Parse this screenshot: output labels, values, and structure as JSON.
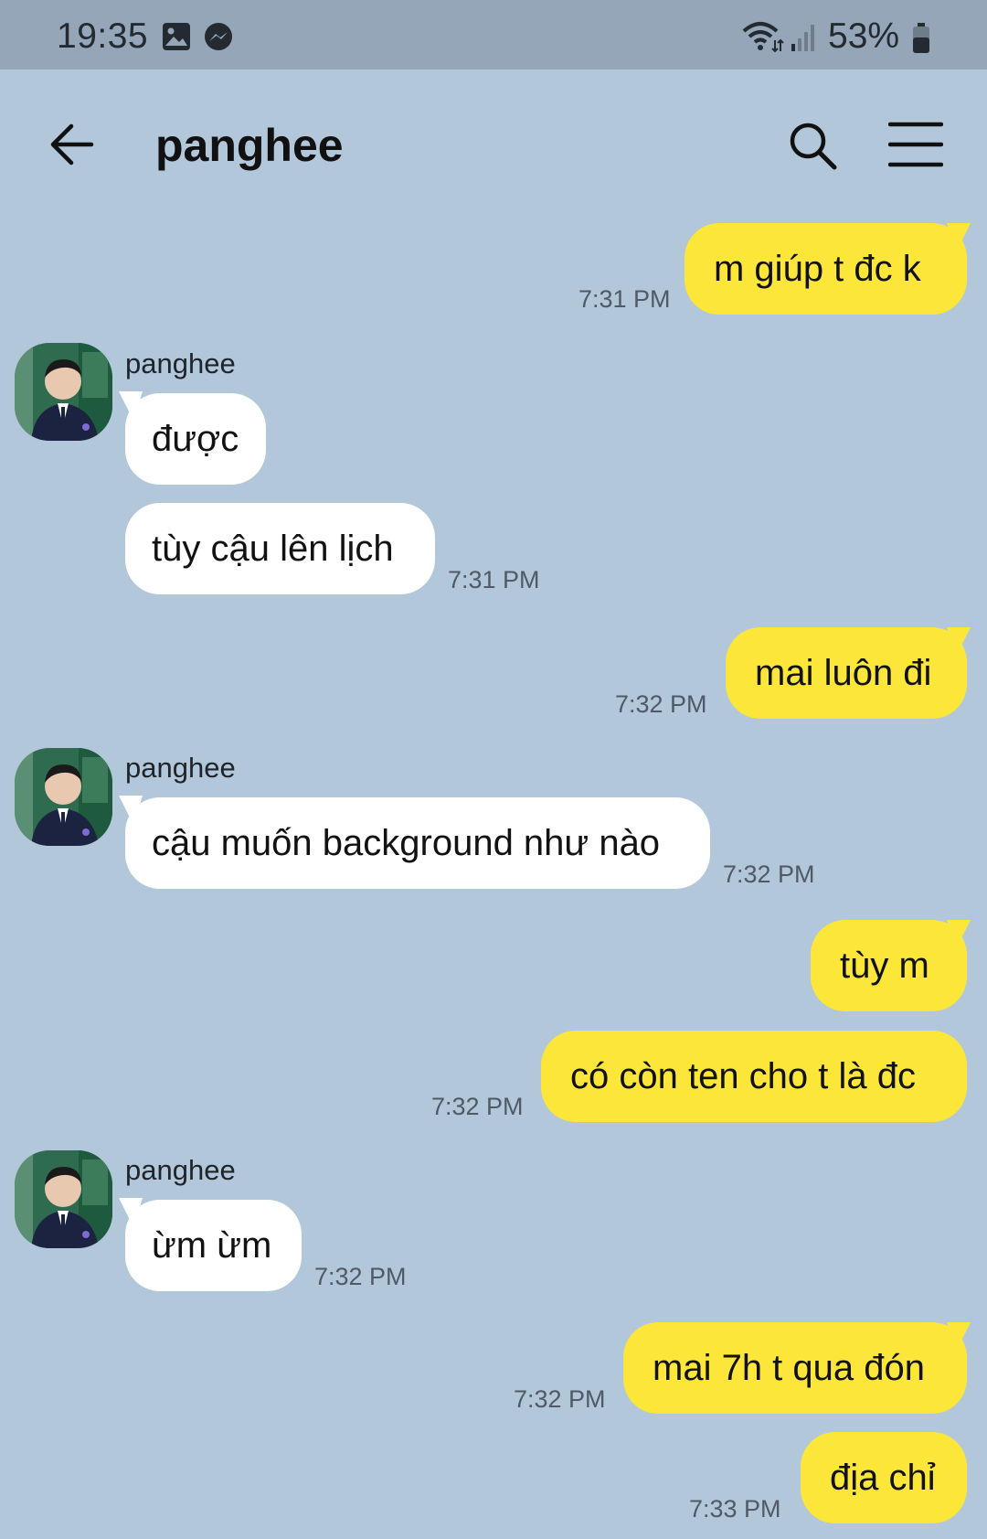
{
  "status_bar": {
    "time": "19:35",
    "battery": "53%",
    "icons": [
      "gallery-icon",
      "messenger-icon",
      "wifi-icon",
      "signal-icon",
      "battery-icon"
    ]
  },
  "header": {
    "title": "panghee",
    "back_icon": "arrow-left-icon",
    "search_icon": "search-icon",
    "menu_icon": "hamburger-menu-icon"
  },
  "colors": {
    "background": "#b2c7da",
    "status_bar": "#94a6b8",
    "my_bubble": "#fde63a",
    "their_bubble": "#ffffff"
  },
  "messages": [
    {
      "from": "me",
      "text": "m giúp t đc k",
      "time": "7:31 PM"
    },
    {
      "from": "them",
      "sender": "panghee",
      "text": "được"
    },
    {
      "from": "them",
      "text": "tùy cậu lên lịch",
      "time": "7:31 PM"
    },
    {
      "from": "me",
      "text": "mai luôn đi",
      "time": "7:32 PM"
    },
    {
      "from": "them",
      "sender": "panghee",
      "text": "cậu muốn background như nào",
      "time": "7:32 PM"
    },
    {
      "from": "me",
      "text": "tùy m"
    },
    {
      "from": "me",
      "text": "có còn ten cho t là đc",
      "time": "7:32 PM"
    },
    {
      "from": "them",
      "sender": "panghee",
      "text": "ừm ừm",
      "time": "7:32 PM"
    },
    {
      "from": "me",
      "text": "mai 7h t qua đón",
      "time": "7:32 PM"
    },
    {
      "from": "me",
      "text": "địa chỉ",
      "time": "7:33 PM"
    }
  ]
}
